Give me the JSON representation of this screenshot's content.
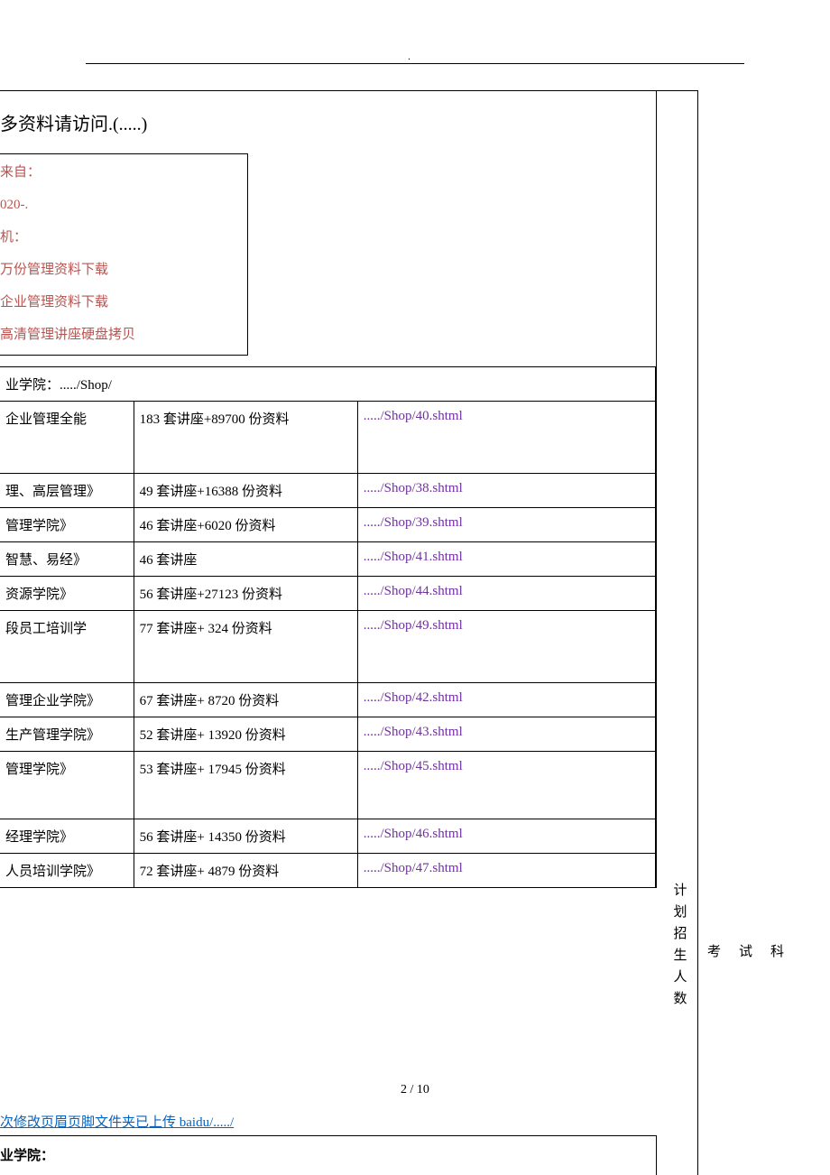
{
  "header_dot": ".",
  "title": "多资料请访问.(.....)",
  "source": {
    "line1": "来自：",
    "line2": "020-.",
    "line3": "机：",
    "line4": "万份管理资料下载",
    "line5": "企业管理资料下载",
    "line6": "高清管理讲座硬盘拷贝"
  },
  "shop_header": "业学院：...../Shop/",
  "rows": [
    {
      "c1": "企业管理全能",
      "c2": "183 套讲座+89700 份资料",
      "c3": "...../Shop/40.shtml"
    },
    {
      "c1": "理、高层管理》",
      "c2": "49 套讲座+16388 份资料",
      "c3": "...../Shop/38.shtml"
    },
    {
      "c1": "管理学院》",
      "c2": "46 套讲座+6020 份资料",
      "c3": "...../Shop/39.shtml"
    },
    {
      "c1": "智慧、易经》",
      "c2": "46 套讲座",
      "c3": "...../Shop/41.shtml"
    },
    {
      "c1": "资源学院》",
      "c2": "56 套讲座+27123 份资料",
      "c3": "...../Shop/44.shtml"
    },
    {
      "c1": "段员工培训学",
      "c2": "77 套讲座+ 324 份资料",
      "c3": "...../Shop/49.shtml"
    },
    {
      "c1": "管理企业学院》",
      "c2": "67 套讲座+ 8720 份资料",
      "c3": "...../Shop/42.shtml"
    },
    {
      "c1": "生产管理学院》",
      "c2": "52 套讲座+ 13920 份资料",
      "c3": "...../Shop/43.shtml"
    },
    {
      "c1": "管理学院》",
      "c2": "53 套讲座+ 17945 份资料",
      "c3": "...../Shop/45.shtml"
    },
    {
      "c1": "经理学院》",
      "c2": "56 套讲座+ 14350 份资料",
      "c3": "...../Shop/46.shtml"
    },
    {
      "c1": "人员培训学院》",
      "c2": "72 套讲座+ 4879 份资料",
      "c3": "...../Shop/47.shtml"
    }
  ],
  "page_num": "2 / 10",
  "footer_link": "次修改页眉页脚文件夹已上传 baidu/...../",
  "bottom_header": "业学院：",
  "vertical_label": "计划招生人数",
  "exam_label": "考试科"
}
